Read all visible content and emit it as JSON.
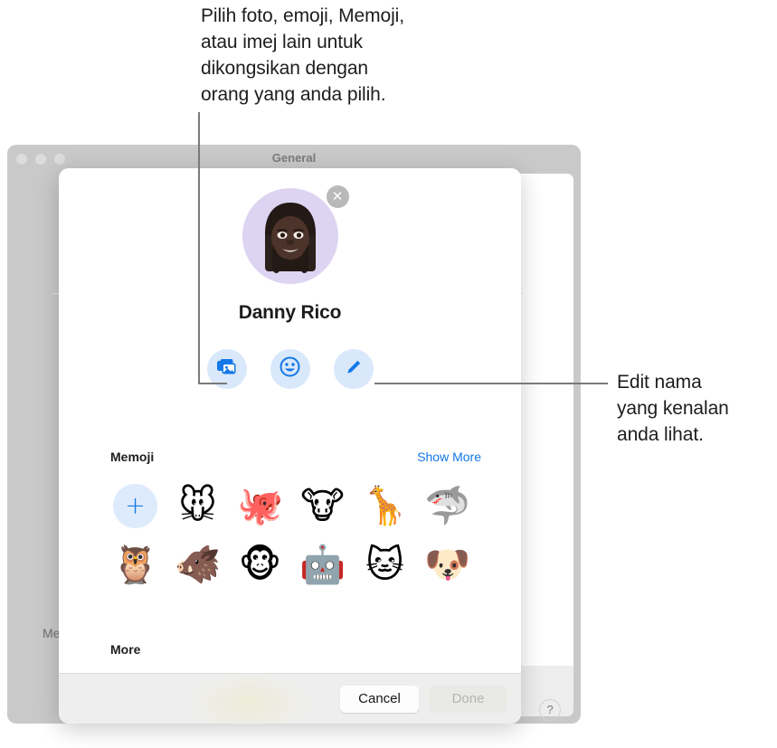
{
  "callouts": {
    "top": "Pilih foto, emoji, Memoji,\natau imej lain untuk\ndikongsikan dengan\norang yang anda pilih.",
    "right": "Edit nama\nyang kenalan\nanda lihat."
  },
  "background_window": {
    "title": "General",
    "partial_label": "Me",
    "help_label": "?"
  },
  "dialog": {
    "contact_name": "Danny Rico",
    "close_label": "✕",
    "actions": [
      {
        "name": "photos",
        "icon": "photos-icon"
      },
      {
        "name": "emoji",
        "icon": "smiley-icon"
      },
      {
        "name": "edit",
        "icon": "pencil-icon"
      }
    ],
    "memoji_section": {
      "title": "Memoji",
      "link": "Show More",
      "add_label": "+",
      "items": [
        {
          "icon": "mouse-face",
          "glyph": "🐭"
        },
        {
          "icon": "octopus",
          "glyph": "🐙"
        },
        {
          "icon": "cow-face",
          "glyph": "🐮"
        },
        {
          "icon": "giraffe",
          "glyph": "🦒"
        },
        {
          "icon": "shark",
          "glyph": "🦈"
        },
        {
          "icon": "owl",
          "glyph": "🦉"
        },
        {
          "icon": "boar",
          "glyph": "🐗"
        },
        {
          "icon": "monkey-face",
          "glyph": "🐵"
        },
        {
          "icon": "robot-face",
          "glyph": "🤖"
        },
        {
          "icon": "cat-face",
          "glyph": "🐱"
        },
        {
          "icon": "dog-face",
          "glyph": "🐶"
        }
      ]
    },
    "more_section": {
      "title": "More"
    },
    "footer": {
      "cancel_label": "Cancel",
      "done_label": "Done"
    }
  },
  "colors": {
    "accent_blue": "#1478e8",
    "action_button_bg": "#d9e8fb",
    "avatar_bg": "#ddd4f2",
    "window_chrome": "#c9c9c9",
    "leader_line": "#7a7a7a"
  }
}
